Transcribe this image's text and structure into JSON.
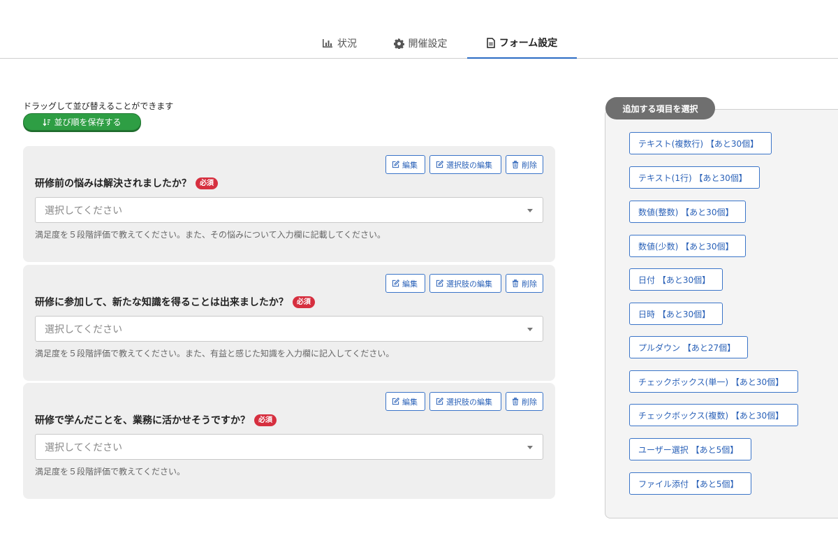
{
  "tabs": [
    {
      "label": "状況",
      "icon": "bar-chart-icon",
      "active": false
    },
    {
      "label": "開催設定",
      "icon": "gear-icon",
      "active": false
    },
    {
      "label": "フォーム設定",
      "icon": "document-icon",
      "active": true
    }
  ],
  "sort": {
    "hint": "ドラッグして並び替えることができます",
    "save_label": "並び順を保存する"
  },
  "card_actions": {
    "edit": "編集",
    "edit_options": "選択肢の編集",
    "delete": "削除"
  },
  "questions": [
    {
      "title": "研修前の悩みは解決されましたか？",
      "required": "必須",
      "placeholder": "選択してください",
      "description": "満足度を５段階評価で教えてください。また、その悩みについて入力欄に記載してください。"
    },
    {
      "title": "研修に参加して、新たな知識を得ることは出来ましたか？",
      "required": "必須",
      "placeholder": "選択してください",
      "description": "満足度を５段階評価で教えてください。また、有益と感じた知識を入力欄に記入してください。"
    },
    {
      "title": "研修で学んだことを、業務に活かせそうですか？",
      "required": "必須",
      "placeholder": "選択してください",
      "description": "満足度を５段階評価で教えてください。"
    }
  ],
  "panel": {
    "title": "追加する項目を選択",
    "items": [
      "テキスト(複数行) 【あと30個】",
      "テキスト(1行) 【あと30個】",
      "数値(整数) 【あと30個】",
      "数値(少数) 【あと30個】",
      "日付 【あと30個】",
      "日時 【あと30個】",
      "プルダウン 【あと27個】",
      "チェックボックス(単一) 【あと30個】",
      "チェックボックス(複数) 【あと30個】",
      "ユーザー選択 【あと5個】",
      "ファイル添付 【あと5個】"
    ]
  },
  "colors": {
    "accent": "#2b6cc4",
    "save_button": "#2e9e44",
    "required_badge": "#d62f3f",
    "card_bg": "#efefef"
  }
}
